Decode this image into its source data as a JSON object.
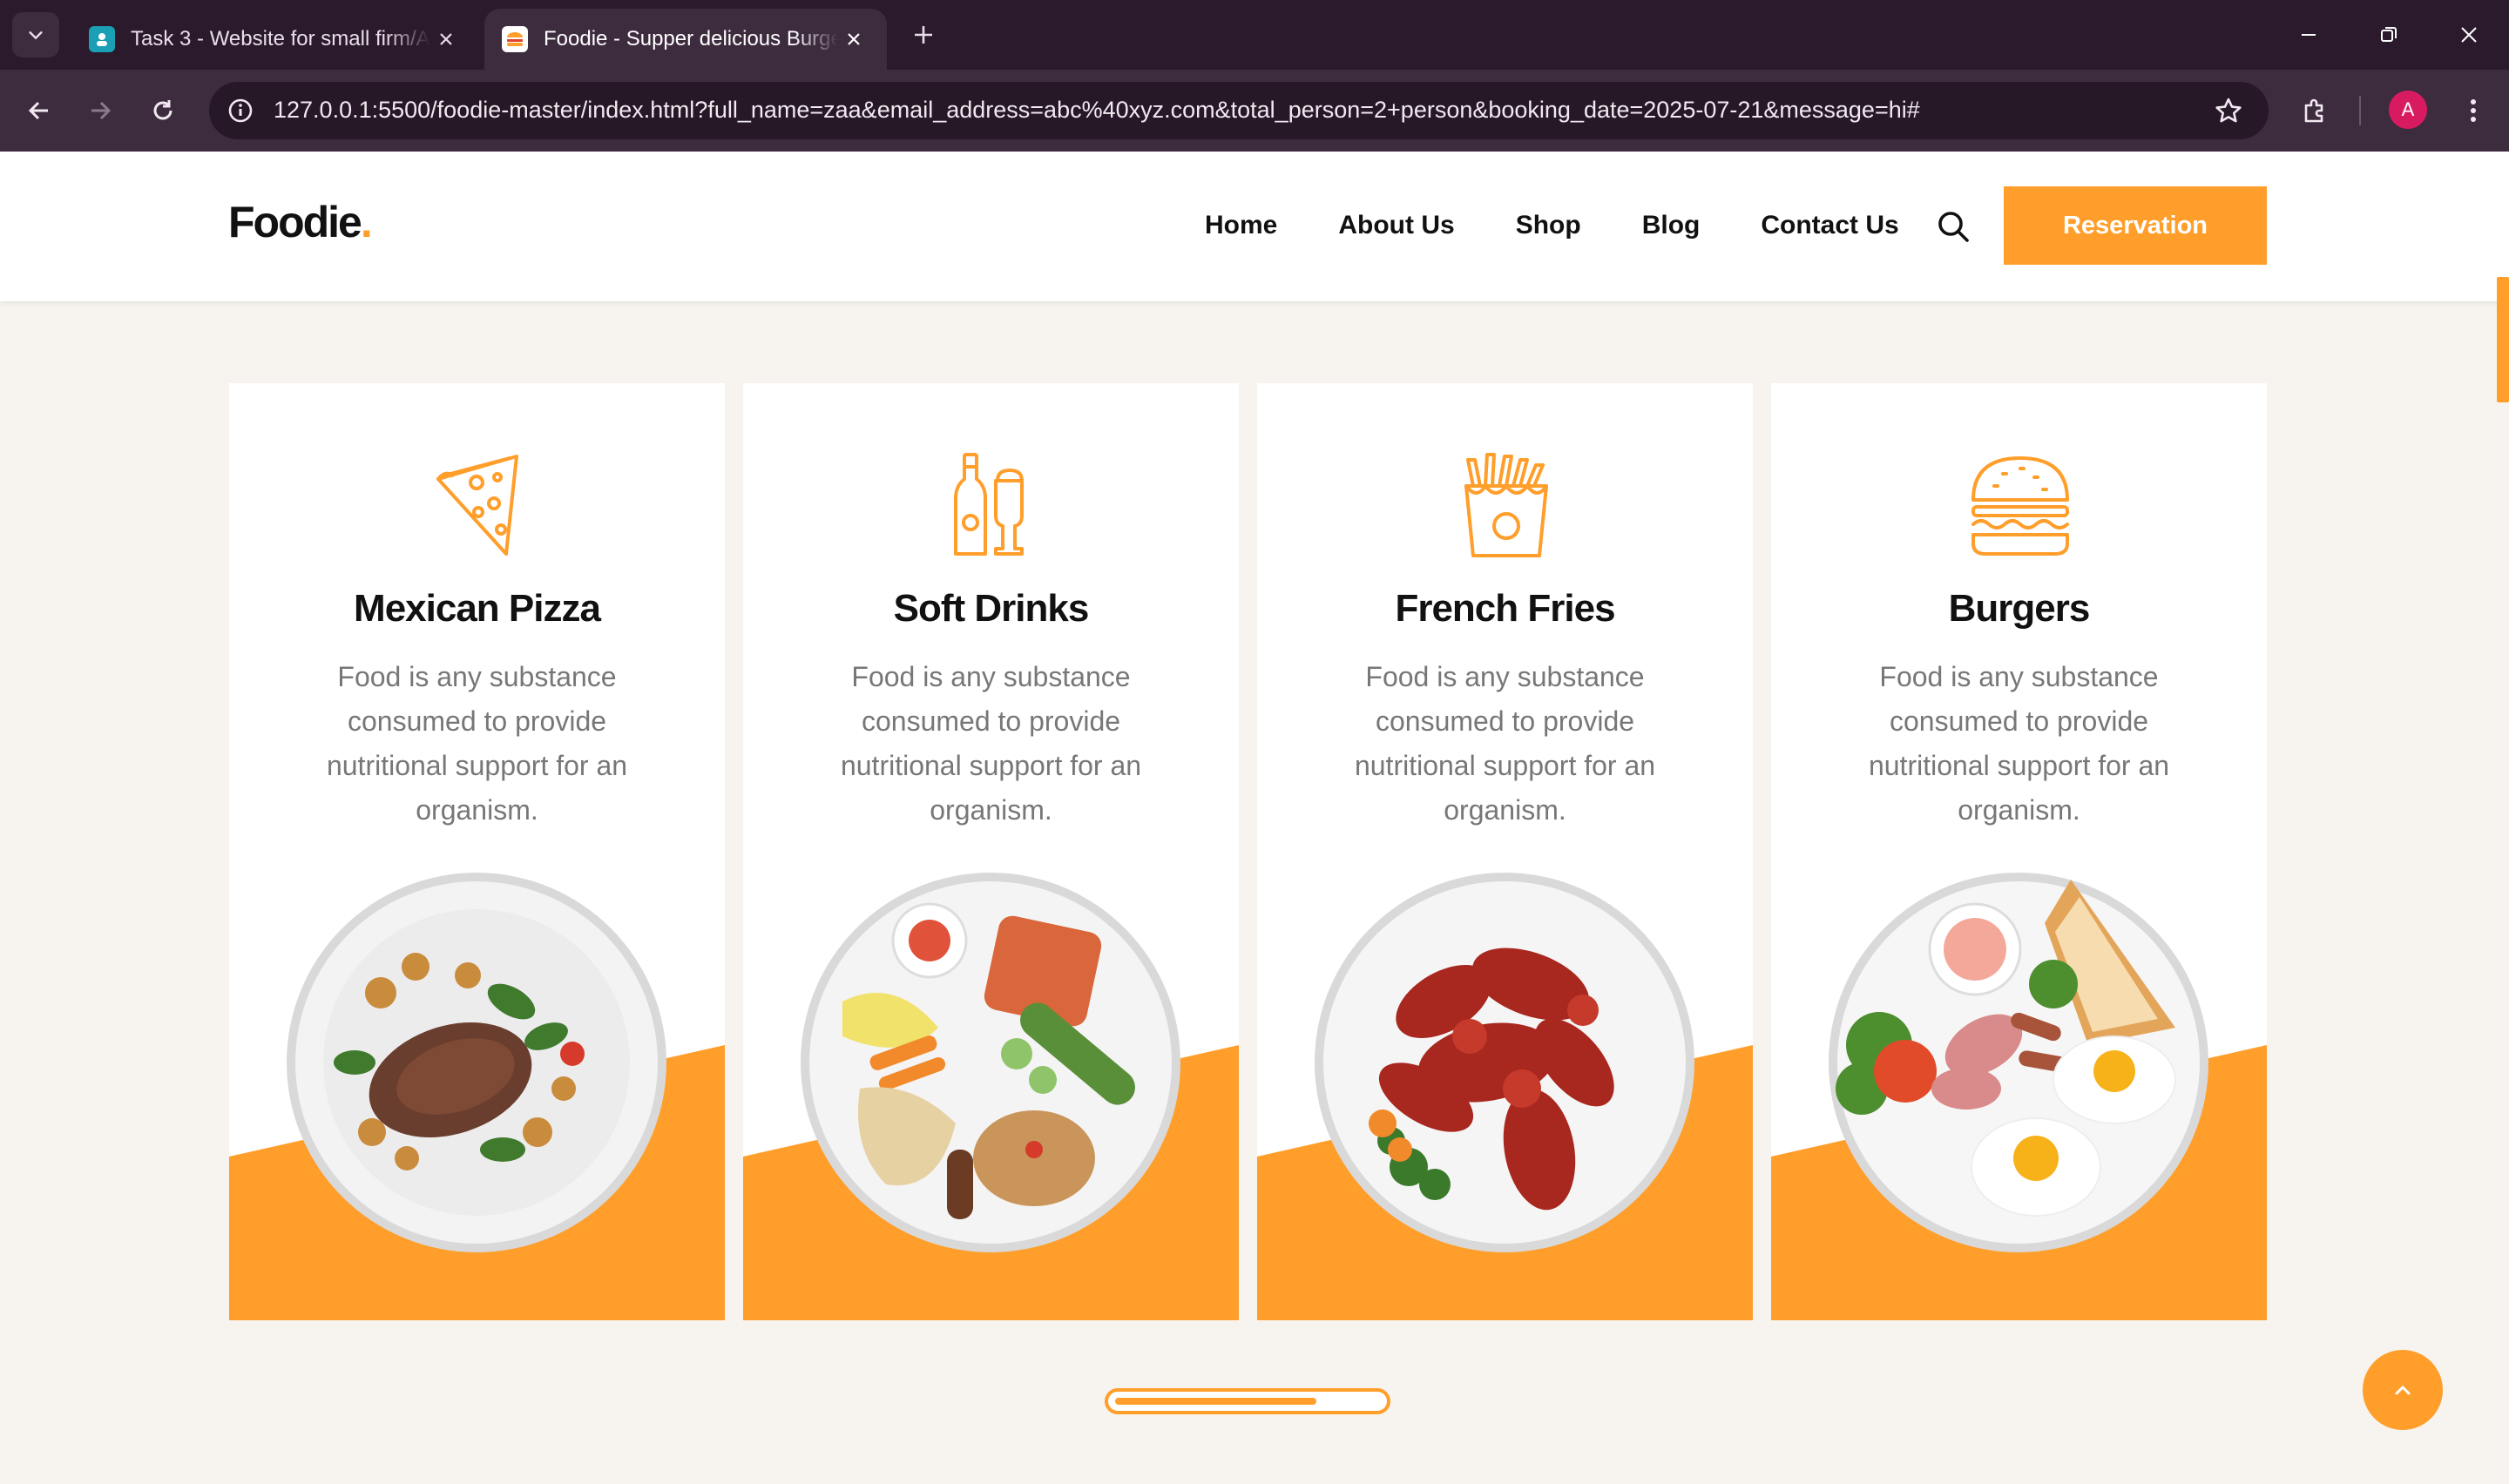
{
  "browser": {
    "tabs": [
      {
        "title": "Task 3 - Website for small firm/A",
        "active": false
      },
      {
        "title": "Foodie - Supper delicious Burger",
        "active": true
      }
    ],
    "url": "127.0.0.1:5500/foodie-master/index.html?full_name=zaa&email_address=abc%40xyz.com&total_person=2+person&booking_date=2025-07-21&message=hi#",
    "profile_initial": "A"
  },
  "header": {
    "logo_text": "Foodie",
    "logo_dot": ".",
    "nav": [
      "Home",
      "About Us",
      "Shop",
      "Blog",
      "Contact Us"
    ],
    "reservation_label": "Reservation"
  },
  "categories": [
    {
      "title": "Mexican Pizza",
      "description": "Food is any substance consumed to provide nutritional support for an organism.",
      "icon": "pizza-slice-icon"
    },
    {
      "title": "Soft Drinks",
      "description": "Food is any substance consumed to provide nutritional support for an organism.",
      "icon": "bottle-and-glass-icon"
    },
    {
      "title": "French Fries",
      "description": "Food is any substance consumed to provide nutritional support for an organism.",
      "icon": "french-fries-icon"
    },
    {
      "title": "Burgers",
      "description": "Food is any substance consumed to provide nutritional support for an organism.",
      "icon": "burger-icon"
    }
  ],
  "slider": {
    "progress": 0.76
  },
  "colors": {
    "accent": "#ff9e2a",
    "tabbar": "#2a1a2b",
    "toolbar": "#3d2b3e",
    "page_bg": "#f7f4ef"
  }
}
